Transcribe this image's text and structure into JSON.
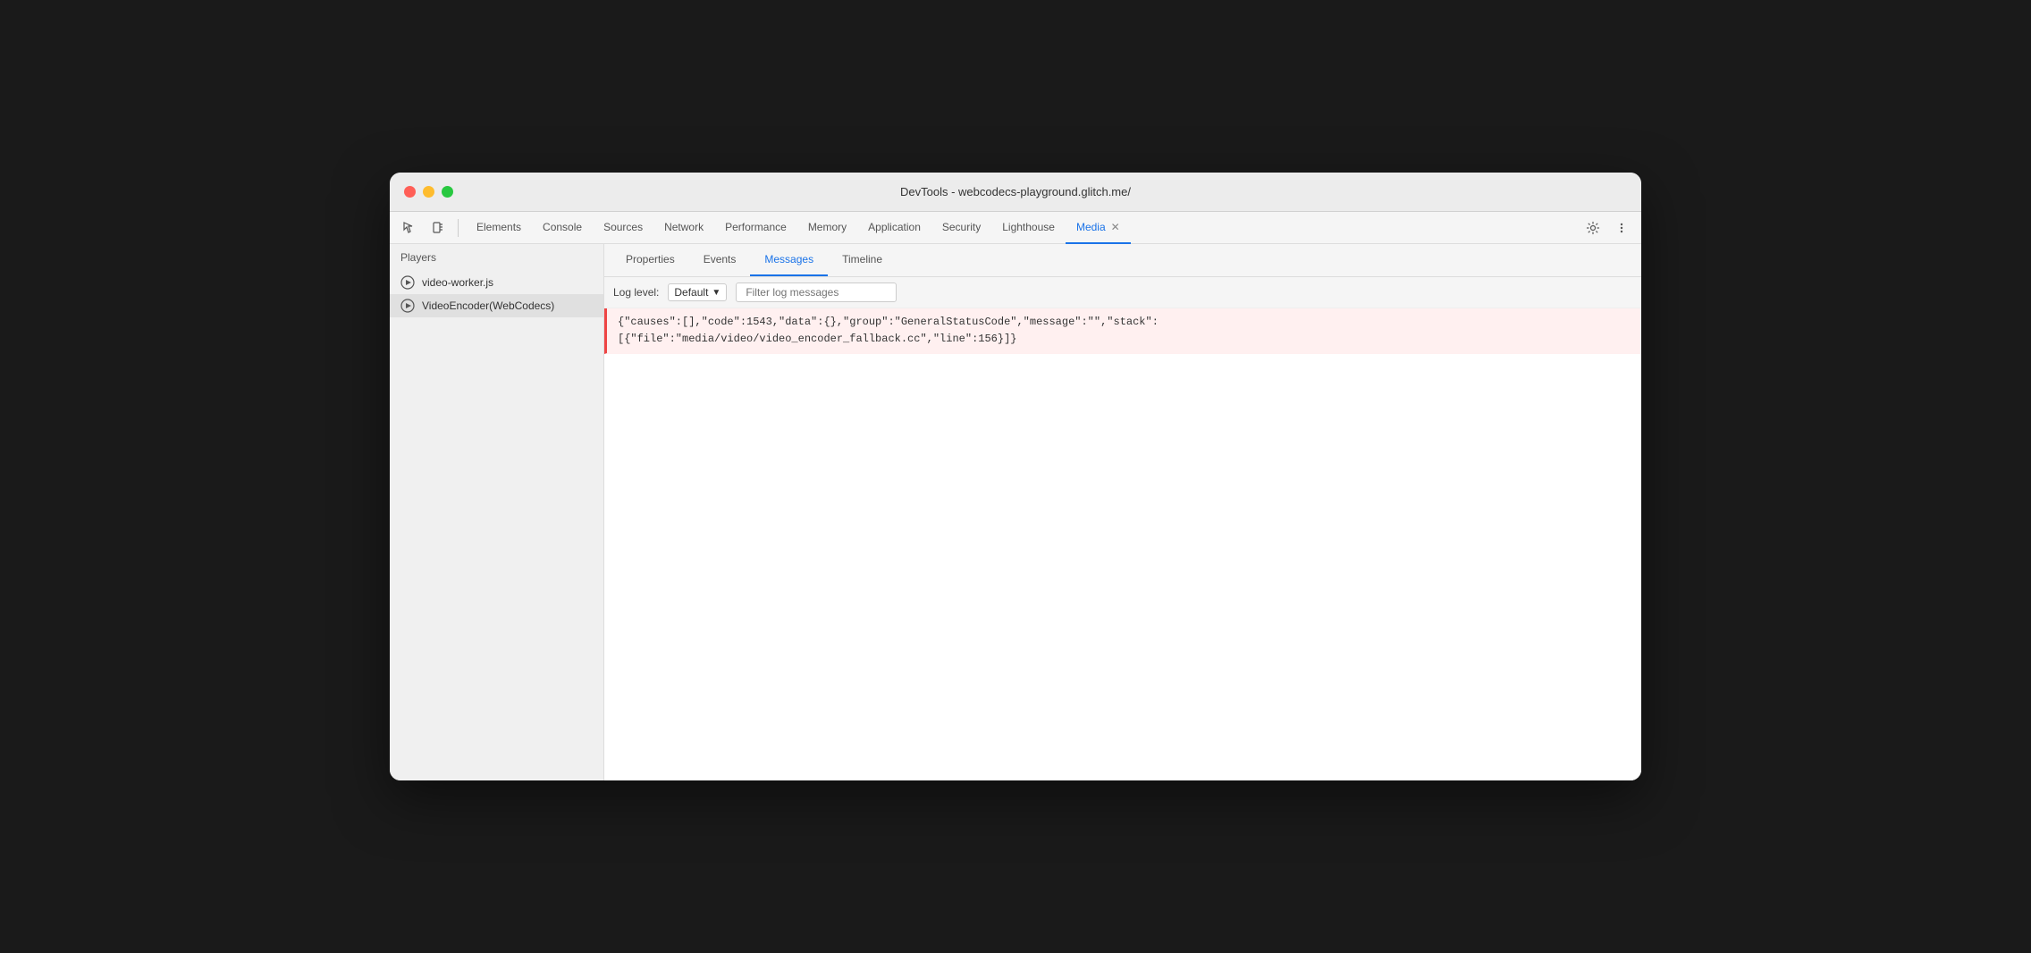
{
  "window": {
    "title": "DevTools - webcodecs-playground.glitch.me/"
  },
  "toolbar": {
    "inspect_label": "Inspect",
    "device_label": "Device",
    "nav_tabs": [
      {
        "id": "elements",
        "label": "Elements",
        "active": false
      },
      {
        "id": "console",
        "label": "Console",
        "active": false
      },
      {
        "id": "sources",
        "label": "Sources",
        "active": false
      },
      {
        "id": "network",
        "label": "Network",
        "active": false
      },
      {
        "id": "performance",
        "label": "Performance",
        "active": false
      },
      {
        "id": "memory",
        "label": "Memory",
        "active": false
      },
      {
        "id": "application",
        "label": "Application",
        "active": false
      },
      {
        "id": "security",
        "label": "Security",
        "active": false
      },
      {
        "id": "lighthouse",
        "label": "Lighthouse",
        "active": false
      },
      {
        "id": "media",
        "label": "Media",
        "active": true,
        "closeable": true
      }
    ],
    "settings_label": "Settings",
    "more_label": "More"
  },
  "sidebar": {
    "header": "Players",
    "players": [
      {
        "id": "video-worker",
        "label": "video-worker.js",
        "active": false
      },
      {
        "id": "video-encoder",
        "label": "VideoEncoder(WebCodecs)",
        "active": true
      }
    ]
  },
  "panel": {
    "sub_tabs": [
      {
        "id": "properties",
        "label": "Properties",
        "active": false
      },
      {
        "id": "events",
        "label": "Events",
        "active": false
      },
      {
        "id": "messages",
        "label": "Messages",
        "active": true
      },
      {
        "id": "timeline",
        "label": "Timeline",
        "active": false
      }
    ],
    "filter_bar": {
      "log_level_label": "Log level:",
      "log_level_value": "Default",
      "filter_placeholder": "Filter log messages"
    },
    "messages": [
      {
        "id": "msg1",
        "type": "error",
        "text": "{\"causes\":[],\"code\":1543,\"data\":{},\"group\":\"GeneralStatusCode\",\"message\":\"\",\"stack\":\n[{\"file\":\"media/video/video_encoder_fallback.cc\",\"line\":156}]}"
      }
    ]
  }
}
